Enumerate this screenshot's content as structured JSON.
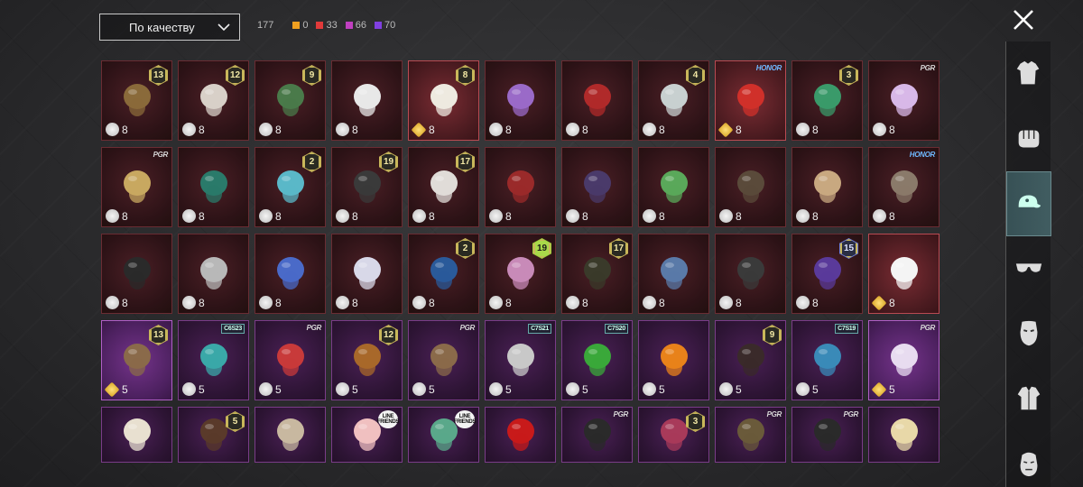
{
  "sort": {
    "label": "По качеству"
  },
  "counts": [
    {
      "value": "177",
      "color": ""
    },
    {
      "value": "0",
      "color": "#f0a020"
    },
    {
      "value": "33",
      "color": "#e03a3a"
    },
    {
      "value": "66",
      "color": "#c040c0"
    },
    {
      "value": "70",
      "color": "#8040e0"
    }
  ],
  "close_icon": "close-icon",
  "sidebar": {
    "items": [
      {
        "name": "outfit-icon",
        "active": false
      },
      {
        "name": "fist-icon",
        "active": false
      },
      {
        "name": "cap-icon",
        "active": true
      },
      {
        "name": "sunglasses-icon",
        "active": false
      },
      {
        "name": "face-mask-icon",
        "active": false
      },
      {
        "name": "jacket-icon",
        "active": false
      },
      {
        "name": "head-icon",
        "active": false
      }
    ]
  },
  "rows": [
    [
      {
        "qty": "8",
        "level": "13",
        "currency": "silver",
        "art": "#8a6a3a"
      },
      {
        "qty": "8",
        "level": "12",
        "currency": "silver",
        "art": "#d8d0c8"
      },
      {
        "qty": "8",
        "level": "9",
        "currency": "silver",
        "art": "#4a7a4a"
      },
      {
        "qty": "8",
        "currency": "silver",
        "art": "#e8e8e8"
      },
      {
        "qty": "8",
        "level": "8",
        "currency": "gold",
        "art": "#eeeae0",
        "bright": true
      },
      {
        "qty": "8",
        "currency": "silver",
        "art": "#9a6ac8"
      },
      {
        "qty": "8",
        "currency": "silver",
        "art": "#b02a2a"
      },
      {
        "qty": "8",
        "level": "4",
        "currency": "silver",
        "art": "#c8d0d0"
      },
      {
        "qty": "8",
        "tag": "HONOR",
        "tag_type": "honor",
        "currency": "gold",
        "art": "#d0302a",
        "bright": true
      },
      {
        "qty": "8",
        "level": "3",
        "currency": "silver",
        "art": "#3a9a6a"
      },
      {
        "qty": "8",
        "tag": "PGR",
        "tag_type": "pg",
        "currency": "silver",
        "art": "#d8b8e8"
      }
    ],
    [
      {
        "qty": "8",
        "tag": "PGR",
        "tag_type": "pg",
        "currency": "silver",
        "art": "#c8a860"
      },
      {
        "qty": "8",
        "currency": "silver",
        "art": "#2a7a6a"
      },
      {
        "qty": "8",
        "level": "2",
        "currency": "silver",
        "art": "#5ab8c8"
      },
      {
        "qty": "8",
        "level": "19",
        "currency": "silver",
        "art": "#3a3a3a"
      },
      {
        "qty": "8",
        "level": "17",
        "currency": "silver",
        "art": "#e0dcd8"
      },
      {
        "qty": "8",
        "currency": "silver",
        "art": "#9a2a2a"
      },
      {
        "qty": "8",
        "currency": "silver",
        "art": "#4a3a6a"
      },
      {
        "qty": "8",
        "currency": "silver",
        "art": "#5aa85a"
      },
      {
        "qty": "8",
        "currency": "silver",
        "art": "#5a4a3a"
      },
      {
        "qty": "8",
        "currency": "silver",
        "art": "#c8a880"
      },
      {
        "qty": "8",
        "tag": "HONOR",
        "tag_type": "honor",
        "currency": "silver",
        "art": "#8a7a6a"
      }
    ],
    [
      {
        "qty": "8",
        "currency": "silver",
        "art": "#2a2a2a"
      },
      {
        "qty": "8",
        "currency": "silver",
        "art": "#b8b8b8"
      },
      {
        "qty": "8",
        "currency": "silver",
        "art": "#4a6ac8"
      },
      {
        "qty": "8",
        "currency": "silver",
        "art": "#d8d8e8"
      },
      {
        "qty": "8",
        "level": "2",
        "currency": "silver",
        "art": "#2a5a9a"
      },
      {
        "qty": "8",
        "level": "19",
        "level_style": "green",
        "currency": "silver",
        "art": "#c88ab8"
      },
      {
        "qty": "8",
        "level": "17",
        "currency": "silver",
        "art": "#3a3a2a"
      },
      {
        "qty": "8",
        "currency": "silver",
        "art": "#5a7aa8"
      },
      {
        "qty": "8",
        "currency": "silver",
        "art": "#3a3a3a"
      },
      {
        "qty": "8",
        "level": "15",
        "level_style": "blue",
        "currency": "silver",
        "art": "#5a3a9a"
      },
      {
        "qty": "8",
        "currency": "gold",
        "art": "#f4f4f4",
        "bright": true
      }
    ],
    [
      {
        "qty": "5",
        "level": "13",
        "currency": "gold",
        "art": "#8a6a4a",
        "purple": true,
        "bright": true
      },
      {
        "qty": "5",
        "tag": "C6S23",
        "tag_type": "season",
        "currency": "silver",
        "art": "#3aa8a8",
        "purple": true
      },
      {
        "qty": "5",
        "tag": "PGR",
        "tag_type": "pg",
        "currency": "silver",
        "art": "#c83a3a",
        "purple": true
      },
      {
        "qty": "5",
        "level": "12",
        "currency": "silver",
        "art": "#a8682a",
        "purple": true
      },
      {
        "qty": "5",
        "tag": "PGR",
        "tag_type": "pg",
        "currency": "silver",
        "art": "#8a6a4a",
        "purple": true
      },
      {
        "qty": "5",
        "tag": "C7S21",
        "tag_type": "season",
        "currency": "silver",
        "art": "#c8c8c8",
        "purple": true
      },
      {
        "qty": "5",
        "tag": "C7S20",
        "tag_type": "season",
        "currency": "silver",
        "art": "#3aa83a",
        "purple": true
      },
      {
        "qty": "5",
        "currency": "silver",
        "art": "#e8821a",
        "purple": true
      },
      {
        "qty": "5",
        "level": "9",
        "currency": "silver",
        "art": "#3a2a2a",
        "purple": true
      },
      {
        "qty": "5",
        "tag": "C7S19",
        "tag_type": "season",
        "currency": "silver",
        "art": "#3a8ab8",
        "purple": true
      },
      {
        "qty": "5",
        "tag": "PGR",
        "tag_type": "pg",
        "currency": "gold",
        "art": "#e8dcf0",
        "purple": true,
        "bright": true
      }
    ],
    [
      {
        "qty": "",
        "currency": "",
        "art": "#e8e0d0",
        "purple": true,
        "partial": true
      },
      {
        "qty": "",
        "level": "5",
        "currency": "",
        "art": "#5a3a2a",
        "purple": true,
        "partial": true
      },
      {
        "qty": "",
        "currency": "",
        "art": "#c8b8a0",
        "purple": true,
        "partial": true
      },
      {
        "qty": "",
        "tag": "LINE FRIENDS",
        "tag_type": "line",
        "currency": "",
        "art": "#f0c0c0",
        "purple": true,
        "partial": true
      },
      {
        "qty": "",
        "tag": "LINE FRIENDS",
        "tag_type": "line",
        "currency": "",
        "art": "#5aa88a",
        "purple": true,
        "partial": true
      },
      {
        "qty": "",
        "currency": "",
        "art": "#c81a1a",
        "purple": true,
        "partial": true
      },
      {
        "qty": "",
        "tag": "PGR",
        "tag_type": "pg",
        "currency": "",
        "art": "#2a2a2a",
        "purple": true,
        "partial": true
      },
      {
        "qty": "",
        "level": "3",
        "currency": "",
        "art": "#a83a5a",
        "purple": true,
        "partial": true
      },
      {
        "qty": "",
        "tag": "PGR",
        "tag_type": "pg",
        "currency": "",
        "art": "#6a5a3a",
        "purple": true,
        "partial": true
      },
      {
        "qty": "",
        "tag": "PGR",
        "tag_type": "pg",
        "currency": "",
        "art": "#2a2a2a",
        "purple": true,
        "partial": true
      },
      {
        "qty": "",
        "currency": "",
        "art": "#e8d8a8",
        "purple": true,
        "partial": true
      }
    ]
  ]
}
